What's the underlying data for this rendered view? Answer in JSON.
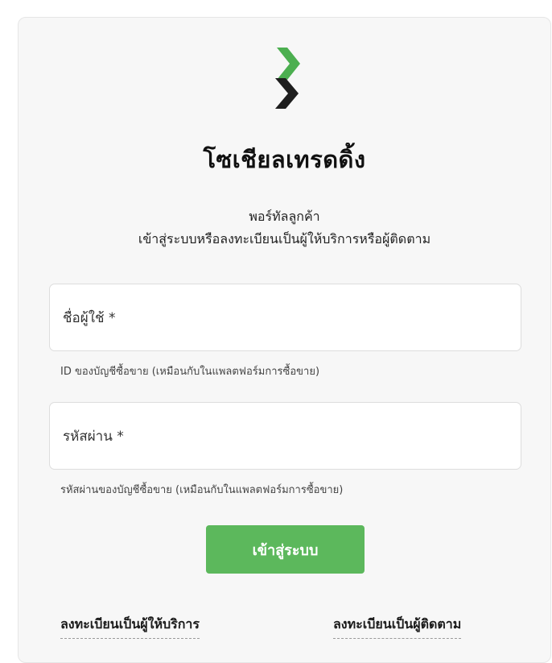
{
  "brand": {
    "logo": "chevron-stack-logo",
    "name": "โซเชียลเทรดดิ้ง"
  },
  "header": {
    "line1": "พอร์ทัลลูกค้า",
    "line2": "เข้าสู่ระบบหรือลงทะเบียนเป็นผู้ให้บริการหรือผู้ติดตาม"
  },
  "form": {
    "username": {
      "label": "ชื่อผู้ใช้ *",
      "value": "",
      "hint": "ID ของบัญชีซื้อขาย (เหมือนกับในแพลตฟอร์มการซื้อขาย)"
    },
    "password": {
      "label": "รหัสผ่าน *",
      "value": "",
      "hint": "รหัสผ่านของบัญชีซื้อขาย (เหมือนกับในแพลตฟอร์มการซื้อขาย)"
    },
    "login_label": "เข้าสู่ระบบ"
  },
  "footer": {
    "register_provider": "ลงทะเบียนเป็นผู้ให้บริการ",
    "register_follower": "ลงทะเบียนเป็นผู้ติดตาม"
  },
  "colors": {
    "accent_green": "#5cb85c",
    "logo_green": "#4caf50",
    "logo_dark": "#1e1e1e",
    "card_background": "#f7f7f7"
  }
}
